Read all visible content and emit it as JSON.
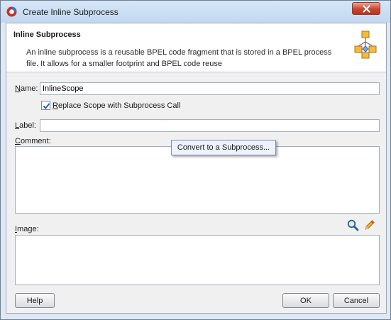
{
  "window": {
    "title": "Create Inline Subprocess"
  },
  "header": {
    "title": "Inline Subprocess",
    "description": "An inline subprocess is a reusable BPEL code fragment that is stored in a BPEL process file. It allows for a smaller footprint and BPEL code reuse"
  },
  "form": {
    "name_label_key": "N",
    "name_label_rest": "ame:",
    "name_value": "InlineScope",
    "replace_checked": true,
    "replace_label_key": "R",
    "replace_label_rest": "eplace Scope with Subprocess Call",
    "label_label_key": "L",
    "label_label_rest": "abel:",
    "label_value": "",
    "comment_label_key": "C",
    "comment_label_rest": "omment:",
    "image_label_key": "I",
    "image_label_rest": "mage:"
  },
  "tooltip": {
    "text": "Convert to a Subprocess..."
  },
  "buttons": {
    "help": "Help",
    "ok": "OK",
    "cancel": "Cancel"
  },
  "icons": {
    "app": "oracle-jdev-icon",
    "header": "flowchart-icon",
    "search": "magnifier-icon",
    "edit": "pencil-icon",
    "close": "close-icon"
  },
  "colors": {
    "accent": "#c9462f",
    "title_bar": "#c2d7ef",
    "panel": "#f0f0f0"
  }
}
